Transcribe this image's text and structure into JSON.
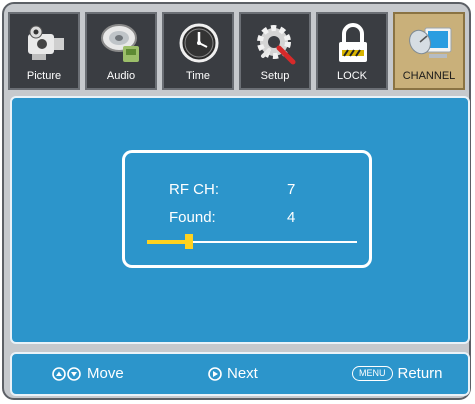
{
  "tabs": [
    {
      "label": "Picture",
      "icon": "camera-icon",
      "active": false
    },
    {
      "label": "Audio",
      "icon": "audio-speaker-icon",
      "active": false
    },
    {
      "label": "Time",
      "icon": "clock-icon",
      "active": false
    },
    {
      "label": "Setup",
      "icon": "gear-wrench-icon",
      "active": false
    },
    {
      "label": "LOCK",
      "icon": "padlock-icon",
      "active": false
    },
    {
      "label": "CHANNEL",
      "icon": "satellite-dish-icon",
      "active": true
    }
  ],
  "scan": {
    "rf_ch_label": "RF CH:",
    "rf_ch_value": "7",
    "found_label": "Found:",
    "found_value": "4",
    "progress": 0.2
  },
  "footer": {
    "move_label": "Move",
    "next_label": "Next",
    "menu_key": "MENU",
    "return_label": "Return"
  },
  "colors": {
    "panel_blue": "#2c95cb",
    "progress_yellow": "#ffd21f",
    "active_tab": "#c9b07a"
  }
}
